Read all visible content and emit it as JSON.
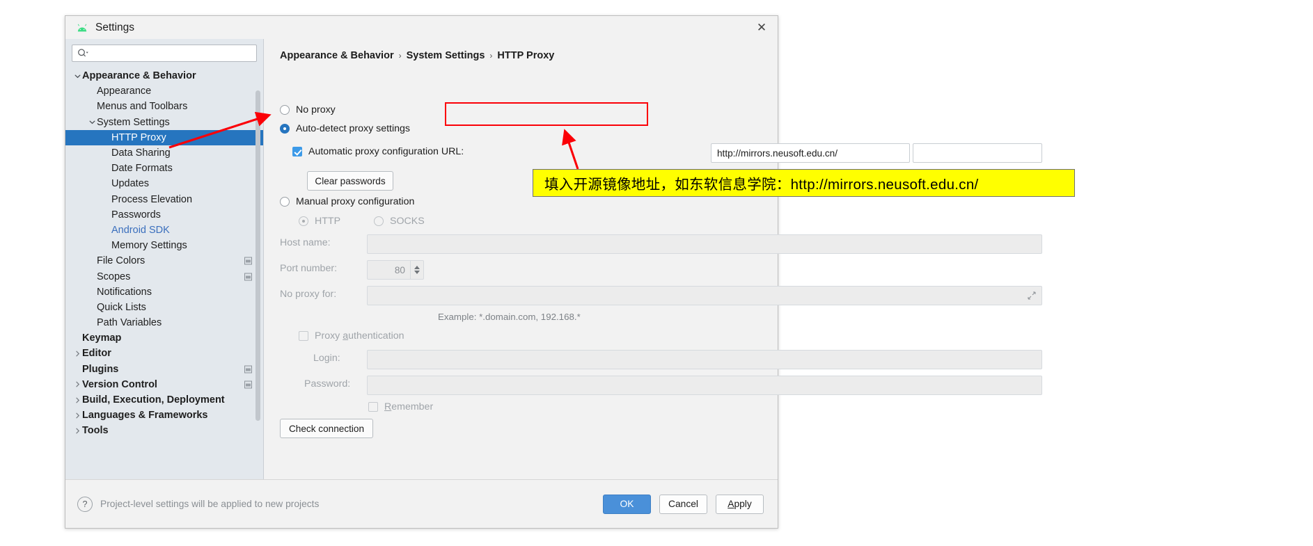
{
  "window": {
    "title": "Settings",
    "icon": "android-icon",
    "close_label": "✕"
  },
  "sidebar": {
    "search_placeholder": "",
    "search_value": "",
    "items": [
      {
        "label": "Appearance & Behavior",
        "indent": 0,
        "twisty": "down",
        "bold": true,
        "selected": false,
        "link": false,
        "proj_icon": false
      },
      {
        "label": "Appearance",
        "indent": 1,
        "twisty": "none",
        "bold": false,
        "selected": false,
        "link": false,
        "proj_icon": false
      },
      {
        "label": "Menus and Toolbars",
        "indent": 1,
        "twisty": "none",
        "bold": false,
        "selected": false,
        "link": false,
        "proj_icon": false
      },
      {
        "label": "System Settings",
        "indent": 1,
        "twisty": "down",
        "bold": false,
        "selected": false,
        "link": false,
        "proj_icon": false
      },
      {
        "label": "HTTP Proxy",
        "indent": 2,
        "twisty": "none",
        "bold": false,
        "selected": true,
        "link": false,
        "proj_icon": false
      },
      {
        "label": "Data Sharing",
        "indent": 2,
        "twisty": "none",
        "bold": false,
        "selected": false,
        "link": false,
        "proj_icon": false
      },
      {
        "label": "Date Formats",
        "indent": 2,
        "twisty": "none",
        "bold": false,
        "selected": false,
        "link": false,
        "proj_icon": false
      },
      {
        "label": "Updates",
        "indent": 2,
        "twisty": "none",
        "bold": false,
        "selected": false,
        "link": false,
        "proj_icon": false
      },
      {
        "label": "Process Elevation",
        "indent": 2,
        "twisty": "none",
        "bold": false,
        "selected": false,
        "link": false,
        "proj_icon": false
      },
      {
        "label": "Passwords",
        "indent": 2,
        "twisty": "none",
        "bold": false,
        "selected": false,
        "link": false,
        "proj_icon": false
      },
      {
        "label": "Android SDK",
        "indent": 2,
        "twisty": "none",
        "bold": false,
        "selected": false,
        "link": true,
        "proj_icon": false
      },
      {
        "label": "Memory Settings",
        "indent": 2,
        "twisty": "none",
        "bold": false,
        "selected": false,
        "link": false,
        "proj_icon": false
      },
      {
        "label": "File Colors",
        "indent": 1,
        "twisty": "none",
        "bold": false,
        "selected": false,
        "link": false,
        "proj_icon": true
      },
      {
        "label": "Scopes",
        "indent": 1,
        "twisty": "none",
        "bold": false,
        "selected": false,
        "link": false,
        "proj_icon": true
      },
      {
        "label": "Notifications",
        "indent": 1,
        "twisty": "none",
        "bold": false,
        "selected": false,
        "link": false,
        "proj_icon": false
      },
      {
        "label": "Quick Lists",
        "indent": 1,
        "twisty": "none",
        "bold": false,
        "selected": false,
        "link": false,
        "proj_icon": false
      },
      {
        "label": "Path Variables",
        "indent": 1,
        "twisty": "none",
        "bold": false,
        "selected": false,
        "link": false,
        "proj_icon": false
      },
      {
        "label": "Keymap",
        "indent": 0,
        "twisty": "none",
        "bold": true,
        "selected": false,
        "link": false,
        "proj_icon": false
      },
      {
        "label": "Editor",
        "indent": 0,
        "twisty": "right",
        "bold": true,
        "selected": false,
        "link": false,
        "proj_icon": false
      },
      {
        "label": "Plugins",
        "indent": 0,
        "twisty": "none",
        "bold": true,
        "selected": false,
        "link": false,
        "proj_icon": true
      },
      {
        "label": "Version Control",
        "indent": 0,
        "twisty": "right",
        "bold": true,
        "selected": false,
        "link": false,
        "proj_icon": true
      },
      {
        "label": "Build, Execution, Deployment",
        "indent": 0,
        "twisty": "right",
        "bold": true,
        "selected": false,
        "link": false,
        "proj_icon": false
      },
      {
        "label": "Languages & Frameworks",
        "indent": 0,
        "twisty": "right",
        "bold": true,
        "selected": false,
        "link": false,
        "proj_icon": false
      },
      {
        "label": "Tools",
        "indent": 0,
        "twisty": "right",
        "bold": true,
        "selected": false,
        "link": false,
        "proj_icon": false
      }
    ]
  },
  "main": {
    "breadcrumb": [
      "Appearance & Behavior",
      "System Settings",
      "HTTP Proxy"
    ],
    "breadcrumb_separator": "›",
    "no_proxy": {
      "label": "No proxy",
      "selected": false
    },
    "auto_detect": {
      "label": "Auto-detect proxy settings",
      "selected": true
    },
    "auto_url": {
      "label": "Automatic proxy configuration URL:",
      "checked": true,
      "value": "http://mirrors.neusoft.edu.cn/"
    },
    "clear_passwords_label": "Clear passwords",
    "manual_proxy": {
      "label": "Manual proxy configuration",
      "selected": false
    },
    "protocol": {
      "http": {
        "label": "HTTP",
        "selected": true
      },
      "socks": {
        "label": "SOCKS",
        "selected": false
      }
    },
    "host_name": {
      "label": "Host name:",
      "value": ""
    },
    "port_number": {
      "label": "Port number:",
      "value": "80"
    },
    "no_proxy_for": {
      "label": "No proxy for:",
      "value": ""
    },
    "example_hint": "Example: *.domain.com, 192.168.*",
    "proxy_auth": {
      "label": "Proxy authentication",
      "label_prefix": "Proxy ",
      "label_underlined": "a",
      "label_suffix": "uthentication",
      "checked": false
    },
    "login": {
      "label": "Login:",
      "value": ""
    },
    "password": {
      "label": "Password:",
      "value": ""
    },
    "remember": {
      "label_prefix": "",
      "label_underlined": "R",
      "label_suffix": "emember",
      "checked": false
    },
    "check_connection_label": "Check connection"
  },
  "bottom": {
    "help_icon": "?",
    "note": "Project-level settings will be applied to new projects",
    "ok_label": "OK",
    "cancel_label": "Cancel",
    "apply_prefix": "",
    "apply_underlined": "A",
    "apply_suffix": "pply"
  },
  "annotations": {
    "callout_text": "填入开源镜像地址，如东软信息学院：http://mirrors.neusoft.edu.cn/",
    "highlight_color": "#ffff00",
    "arrow_color": "#fb0007",
    "box_color": "#fb0007"
  },
  "colors": {
    "accent": "#2675bf",
    "checkbox_blue": "#3c9ae8",
    "ok_button": "#4a90d9",
    "sidebar_bg": "#e3e8ed",
    "panel_bg": "#f2f2f2",
    "link": "#3b6fbd"
  }
}
